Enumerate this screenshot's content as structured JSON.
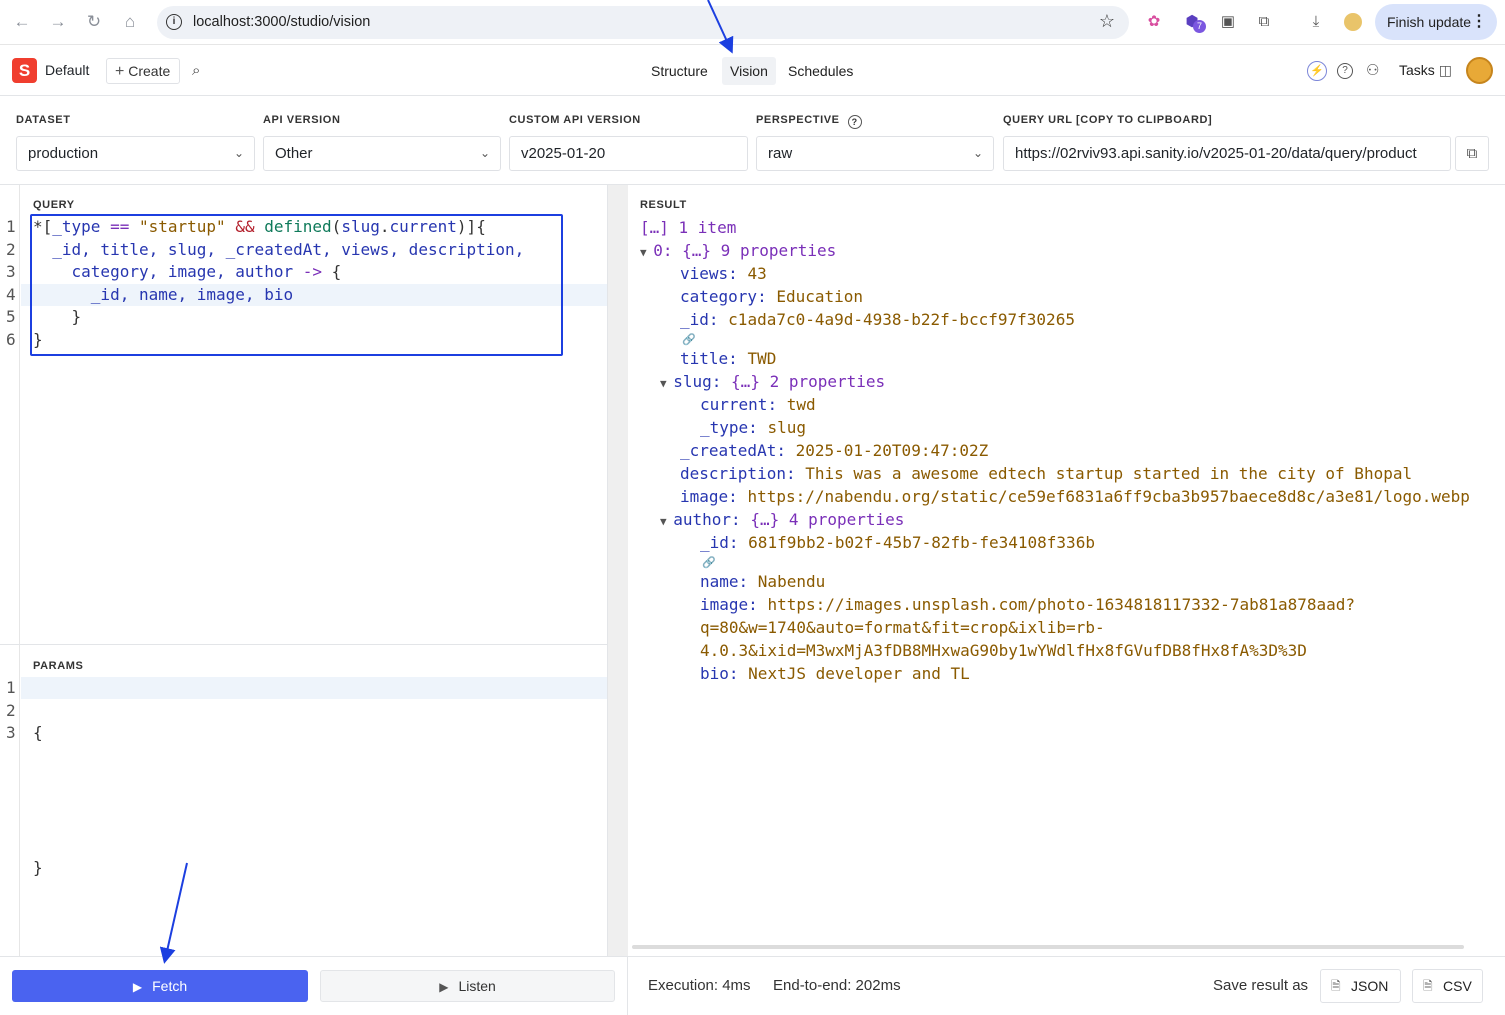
{
  "browser": {
    "url": "localhost:3000/studio/vision",
    "finish_update": "Finish update",
    "ext_badge": "7"
  },
  "studio": {
    "logo_letter": "S",
    "workspace": "Default",
    "create_label": "Create",
    "tools": [
      "Structure",
      "Vision",
      "Schedules"
    ],
    "active_tool": "Vision",
    "tasks_label": "Tasks"
  },
  "config": {
    "dataset": {
      "label": "DATASET",
      "value": "production"
    },
    "api_version": {
      "label": "API VERSION",
      "value": "Other"
    },
    "custom_api_version": {
      "label": "CUSTOM API VERSION",
      "value": "v2025-01-20"
    },
    "perspective": {
      "label": "PERSPECTIVE",
      "value": "raw"
    },
    "query_url": {
      "label": "QUERY URL [COPY TO CLIPBOARD]",
      "value": "https://02rviv93.api.sanity.io/v2025-01-20/data/query/product"
    }
  },
  "query": {
    "header": "QUERY",
    "line_numbers": [
      "1",
      "2",
      "3",
      "4",
      "5",
      "6"
    ]
  },
  "params": {
    "header": "PARAMS",
    "line_numbers": [
      "1",
      "2",
      "3"
    ],
    "lines": [
      "{",
      "",
      "}"
    ]
  },
  "result": {
    "header": "RESULT",
    "root": "[…] 1 item",
    "item0": "0: {…} 9 properties",
    "views": {
      "key": "views",
      "value": "43"
    },
    "category": {
      "key": "category",
      "value": "Education"
    },
    "id": {
      "key": "_id",
      "value": "c1ada7c0-4a9d-4938-b22f-bccf97f30265"
    },
    "title": {
      "key": "title",
      "value": "TWD"
    },
    "slug": {
      "key": "slug",
      "summary": "{…} 2 properties"
    },
    "slug_current": {
      "key": "current",
      "value": "twd"
    },
    "slug_type": {
      "key": "_type",
      "value": "slug"
    },
    "createdAt": {
      "key": "_createdAt",
      "value": "2025-01-20T09:47:02Z"
    },
    "description": {
      "key": "description",
      "value": "This was a awesome edtech startup started in the city of Bhopal"
    },
    "image": {
      "key": "image",
      "value": "https://nabendu.org/static/ce59ef6831a6ff9cba3b957baece8d8c/a3e81/logo.webp"
    },
    "author": {
      "key": "author",
      "summary": "{…} 4 properties"
    },
    "author_id": {
      "key": "_id",
      "value": "681f9bb2-b02f-45b7-82fb-fe34108f336b"
    },
    "author_name": {
      "key": "name",
      "value": "Nabendu"
    },
    "author_image": {
      "key": "image",
      "value_lines": [
        "https://images.unsplash.com/photo-1634818117332-7ab81a878aad?",
        "q=80&w=1740&auto=format&fit=crop&ixlib=rb-",
        "4.0.3&ixid=M3wxMjA3fDB8MHxwaG90by1wYWdlfHx8fGVufDB8fHx8fA%3D%3D"
      ]
    },
    "author_bio": {
      "key": "bio",
      "value": "NextJS developer and TL"
    }
  },
  "footer": {
    "fetch_label": "Fetch",
    "listen_label": "Listen",
    "execution": "Execution: 4ms",
    "end_to_end": "End-to-end: 202ms",
    "save_as": "Save result as",
    "json_label": "JSON",
    "csv_label": "CSV"
  },
  "colors": {
    "accent": "#4a63f0",
    "annotation": "#1c3fe0",
    "brand": "#f03e2f"
  }
}
